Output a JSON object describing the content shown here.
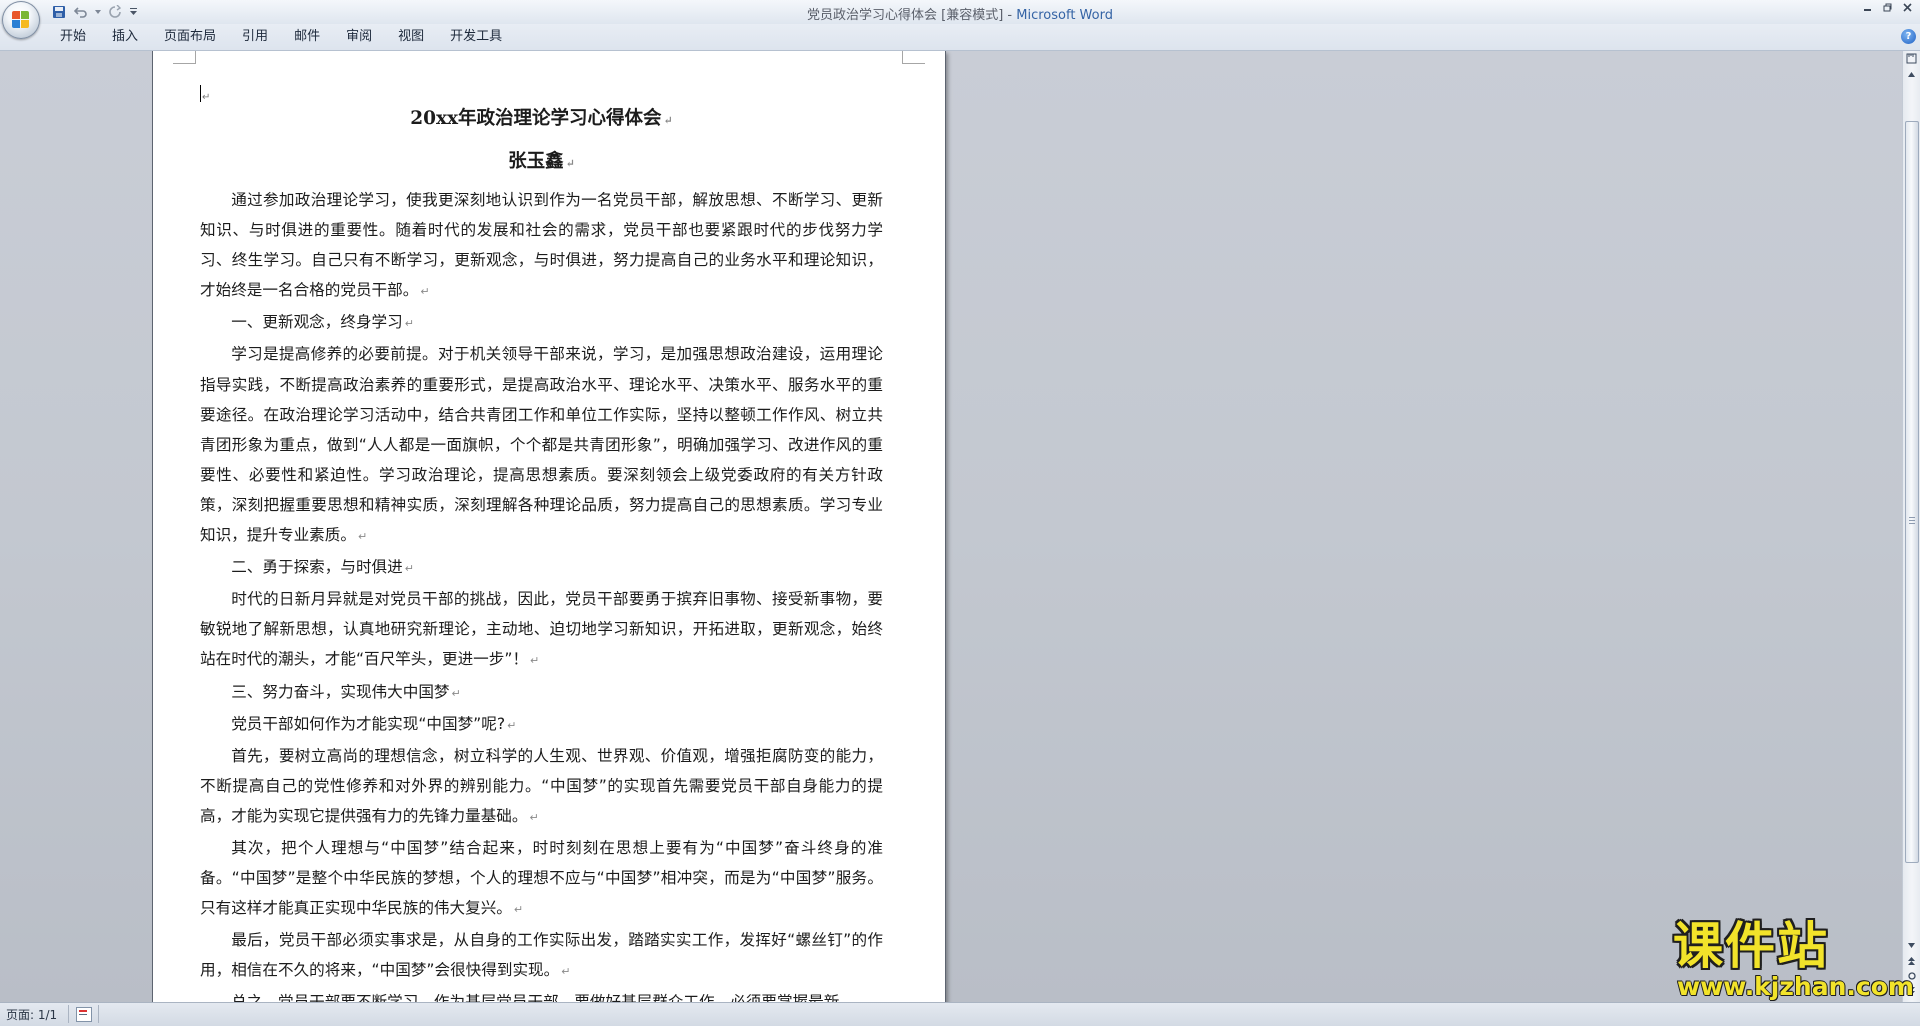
{
  "titlebar": {
    "document_name": "党员政治学习心得体会 [兼容模式]",
    "separator": " - ",
    "app_name": "Microsoft Word"
  },
  "ribbon": {
    "tabs": [
      {
        "label": "开始"
      },
      {
        "label": "插入"
      },
      {
        "label": "页面布局"
      },
      {
        "label": "引用"
      },
      {
        "label": "邮件"
      },
      {
        "label": "审阅"
      },
      {
        "label": "视图"
      },
      {
        "label": "开发工具"
      }
    ],
    "help_label": "?"
  },
  "document": {
    "title": "20xx年政治理论学习心得体会",
    "author": "张玉鑫",
    "paragraphs": [
      "通过参加政治理论学习，使我更深刻地认识到作为一名党员干部，解放思想、不断学习、更新知识、与时俱进的重要性。随着时代的发展和社会的需求，党员干部也要紧跟时代的步伐努力学习、终生学习。自己只有不断学习，更新观念，与时俱进，努力提高自己的业务水平和理论知识，才始终是一名合格的党员干部。",
      "一、更新观念，终身学习",
      "学习是提高修养的必要前提。对于机关领导干部来说，学习，是加强思想政治建设，运用理论指导实践，不断提高政治素养的重要形式，是提高政治水平、理论水平、决策水平、服务水平的重要途径。在政治理论学习活动中，结合共青团工作和单位工作实际，坚持以整顿工作作风、树立共青团形象为重点，做到“人人都是一面旗帜，个个都是共青团形象”，明确加强学习、改进作风的重要性、必要性和紧迫性。学习政治理论，提高思想素质。要深刻领会上级党委政府的有关方针政策，深刻把握重要思想和精神实质，深刻理解各种理论品质，努力提高自己的思想素质。学习专业知识，提升专业素质。",
      "二、勇于探索，与时俱进",
      "时代的日新月异就是对党员干部的挑战，因此，党员干部要勇于摈弃旧事物、接受新事物，要敏锐地了解新思想，认真地研究新理论，主动地、迫切地学习新知识，开拓进取，更新观念，始终站在时代的潮头，才能“百尺竿头，更进一步”！",
      "三、努力奋斗，实现伟大中国梦",
      "党员干部如何作为才能实现“中国梦”呢?",
      "首先，要树立高尚的理想信念，树立科学的人生观、世界观、价值观，增强拒腐防变的能力，不断提高自己的党性修养和对外界的辨别能力。“中国梦”的实现首先需要党员干部自身能力的提高，才能为实现它提供强有力的先锋力量基础。",
      "其次，把个人理想与“中国梦”结合起来，时时刻刻在思想上要有为“中国梦”奋斗终身的准备。“中国梦”是整个中华民族的梦想，个人的理想不应与“中国梦”相冲突，而是为“中国梦”服务。只有这样才能真正实现中华民族的伟大复兴。",
      "最后，党员干部必须实事求是，从自身的工作实际出发，踏踏实实工作，发挥好“螺丝钉”的作用，相信在不久的将来，“中国梦”会很快得到实现。",
      "总之，党员干部要不断学习。作为基层党员干部，要做好基层群众工作，必须要掌握最新、"
    ]
  },
  "statusbar": {
    "page_indicator": "页面: 1/1"
  },
  "watermark": {
    "text": "课件站",
    "url": "www.kjzhan.com"
  },
  "colors": {
    "app_name": "#3463a5",
    "workspace": "#c6cbd3",
    "watermark": "#f2e32a"
  }
}
